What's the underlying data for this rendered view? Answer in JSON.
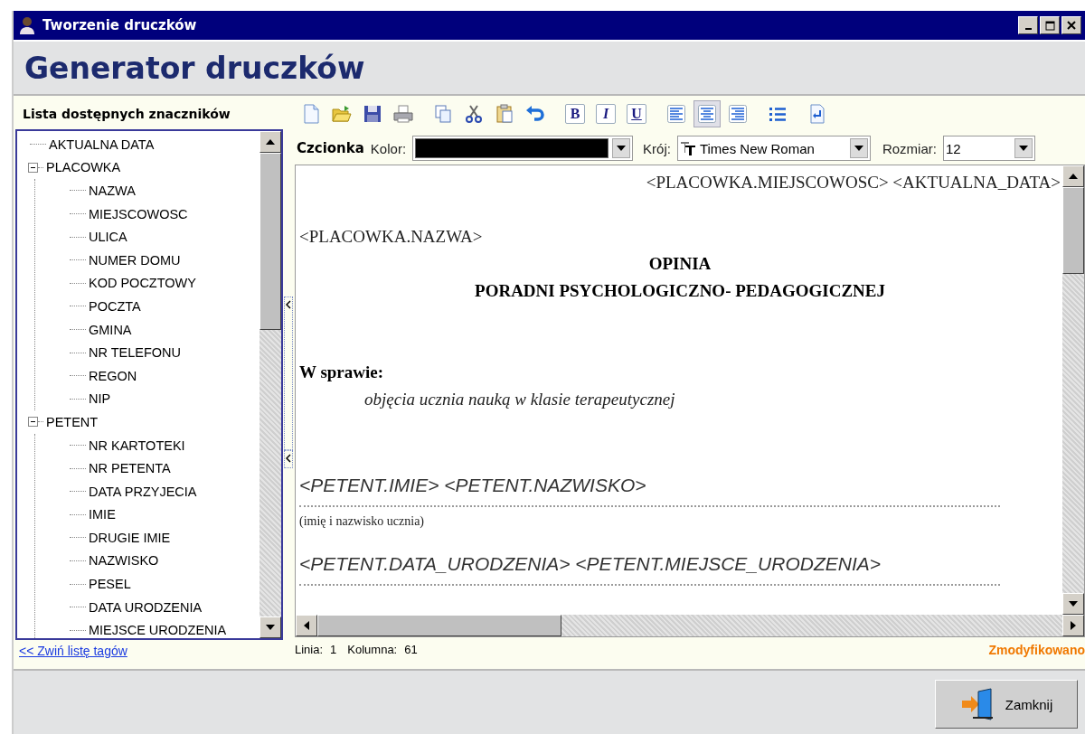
{
  "window": {
    "title": "Tworzenie druczków"
  },
  "header": {
    "title": "Generator druczków"
  },
  "tag_panel": {
    "title": "Lista dostępnych znaczników",
    "collapse_link": "<< Zwiń listę tagów",
    "tree": [
      {
        "label": "AKTUALNA DATA"
      },
      {
        "label": "PLACOWKA",
        "expanded": true,
        "children": [
          {
            "label": "NAZWA"
          },
          {
            "label": "MIEJSCOWOSC"
          },
          {
            "label": "ULICA"
          },
          {
            "label": "NUMER DOMU"
          },
          {
            "label": "KOD POCZTOWY"
          },
          {
            "label": "POCZTA"
          },
          {
            "label": "GMINA"
          },
          {
            "label": "NR TELEFONU"
          },
          {
            "label": "REGON"
          },
          {
            "label": "NIP"
          }
        ]
      },
      {
        "label": "PETENT",
        "expanded": true,
        "children": [
          {
            "label": "NR KARTOTEKI"
          },
          {
            "label": "NR PETENTA"
          },
          {
            "label": "DATA PRZYJECIA"
          },
          {
            "label": "IMIE"
          },
          {
            "label": "DRUGIE IMIE"
          },
          {
            "label": "NAZWISKO"
          },
          {
            "label": "PESEL"
          },
          {
            "label": "DATA URODZENIA"
          },
          {
            "label": "MIEJSCE URODZENIA"
          }
        ]
      }
    ]
  },
  "toolbar": [
    {
      "kind": "new",
      "selected": false
    },
    {
      "kind": "open",
      "selected": false
    },
    {
      "kind": "save",
      "selected": false
    },
    {
      "kind": "print",
      "selected": false
    },
    {
      "kind": "copy",
      "selected": false
    },
    {
      "kind": "cut",
      "selected": false
    },
    {
      "kind": "paste",
      "selected": false
    },
    {
      "kind": "undo",
      "selected": false
    },
    {
      "kind": "bold",
      "label": "B",
      "selected": false
    },
    {
      "kind": "italic",
      "label": "I",
      "selected": false
    },
    {
      "kind": "underline",
      "label": "U",
      "selected": false
    },
    {
      "kind": "align-left",
      "selected": false
    },
    {
      "kind": "align-center",
      "selected": true
    },
    {
      "kind": "align-right",
      "selected": false
    },
    {
      "kind": "list",
      "selected": false
    },
    {
      "kind": "insert",
      "selected": false
    }
  ],
  "font_bar": {
    "title": "Czcionka",
    "color_label": "Kolor:",
    "color": "#000000",
    "face_label": "Krój:",
    "face": "Times New Roman",
    "size_label": "Rozmiar:",
    "size": "12"
  },
  "document": [
    {
      "kind": "right",
      "text": "<PLACOWKA.MIEJSCOWOSC>  <AKTUALNA_DATA>"
    },
    {
      "kind": "blank"
    },
    {
      "kind": "plain",
      "text": "<PLACOWKA.NAZWA>"
    },
    {
      "kind": "title",
      "text": "OPINIA"
    },
    {
      "kind": "title",
      "text": "PORADNI PSYCHOLOGICZNO- PEDAGOGICZNEJ"
    },
    {
      "kind": "blank"
    },
    {
      "kind": "blank"
    },
    {
      "kind": "heading",
      "text": "W sprawie:"
    },
    {
      "kind": "indent-italic",
      "text": "objęcia ucznia nauką w klasie terapeutycznej"
    },
    {
      "kind": "blank"
    },
    {
      "kind": "blank"
    },
    {
      "kind": "field",
      "text": "<PETENT.IMIE>  <PETENT.NAZWISKO>"
    },
    {
      "kind": "rule"
    },
    {
      "kind": "caption",
      "text": "(imię i nazwisko ucznia)"
    },
    {
      "kind": "field",
      "text": "<PETENT.DATA_URODZENIA> <PETENT.MIEJSCE_URODZENIA>"
    },
    {
      "kind": "rule"
    }
  ],
  "status_bar": {
    "line_label": "Linia:",
    "line": "1",
    "column_label": "Kolumna:",
    "column": "61",
    "state": "Zmodyfikowano"
  },
  "footer": {
    "close_button": "Zamknij"
  }
}
